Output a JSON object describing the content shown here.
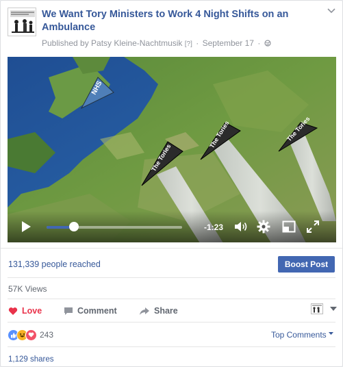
{
  "post": {
    "title": "We Want Tory Ministers to Work 4 Night Shifts on an Ambulance",
    "publisher": "Published by Patsy Kleine-Nachtmusik",
    "help_marker": "[?]",
    "date": "September 17",
    "separator": "·"
  },
  "video": {
    "map_labels": {
      "nhs": "NHS",
      "tories_1": "The Tories",
      "tories_2": "The Tories",
      "tories_3": "The Tories"
    },
    "time_remaining": "-1:23",
    "progress": 0.2,
    "icons": [
      "play-icon",
      "volume-icon",
      "settings-icon",
      "theater-mode-icon",
      "fullscreen-icon"
    ]
  },
  "insights": {
    "reach": "131,339 people reached",
    "boost_label": "Boost Post",
    "views": "57K Views"
  },
  "actions": {
    "love": "Love",
    "comment": "Comment",
    "share": "Share"
  },
  "reactions": {
    "types": [
      "like",
      "haha",
      "love"
    ],
    "count": "243",
    "sort_label": "Top Comments"
  },
  "shares": "1,129 shares",
  "colors": {
    "link": "#365899",
    "brand": "#4267b2",
    "love": "#e9324a"
  }
}
